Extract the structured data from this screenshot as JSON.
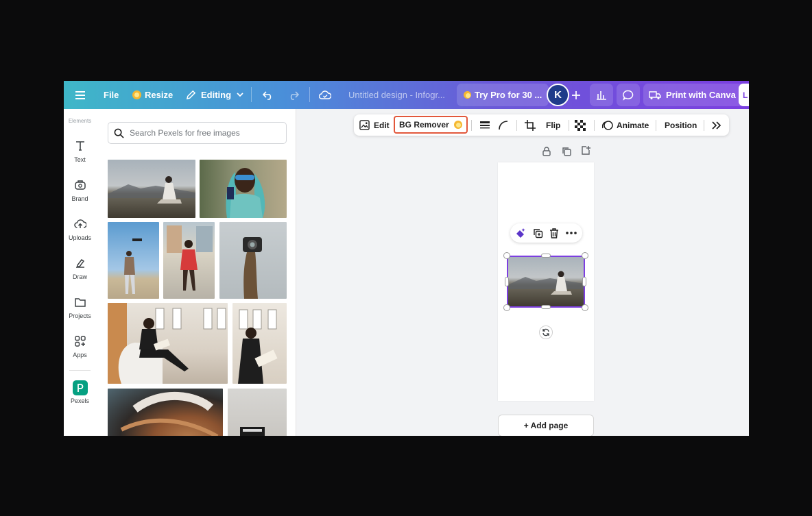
{
  "topbar": {
    "file_label": "File",
    "resize_label": "Resize",
    "editing_label": "Editing",
    "doc_title": "Untitled design - Infogr...",
    "try_pro_label": "Try Pro for 30 ...",
    "avatar_letter": "K",
    "print_label": "Print with Canva",
    "share_partial": "L"
  },
  "rail": {
    "header": "Elements",
    "items": [
      {
        "label": "Text",
        "icon": "text-icon"
      },
      {
        "label": "Brand",
        "icon": "brand-icon"
      },
      {
        "label": "Uploads",
        "icon": "upload-cloud-icon"
      },
      {
        "label": "Draw",
        "icon": "pen-icon"
      },
      {
        "label": "Projects",
        "icon": "folder-icon"
      },
      {
        "label": "Apps",
        "icon": "apps-grid-icon"
      },
      {
        "label": "Pexels",
        "icon": "pexels-icon"
      }
    ]
  },
  "panel": {
    "search_placeholder": "Search Pexels for free images",
    "photos": [
      "man sitting on mountain ridge",
      "woman with blue braids and sunglasses",
      "man flying a drone",
      "woman in red dress on street",
      "hand holding camera",
      "woman reading by window",
      "woman reading book",
      "abstract swirl",
      "frame on table"
    ]
  },
  "context_toolbar": {
    "edit_label": "Edit",
    "bg_remover_label": "BG Remover",
    "flip_label": "Flip",
    "animate_label": "Animate",
    "position_label": "Position"
  },
  "canvas": {
    "add_page_label": "+ Add page"
  },
  "colors": {
    "accent_purple": "#7d3fe0",
    "highlight_red": "#e2573b",
    "pro_gold": "#f5b731"
  }
}
